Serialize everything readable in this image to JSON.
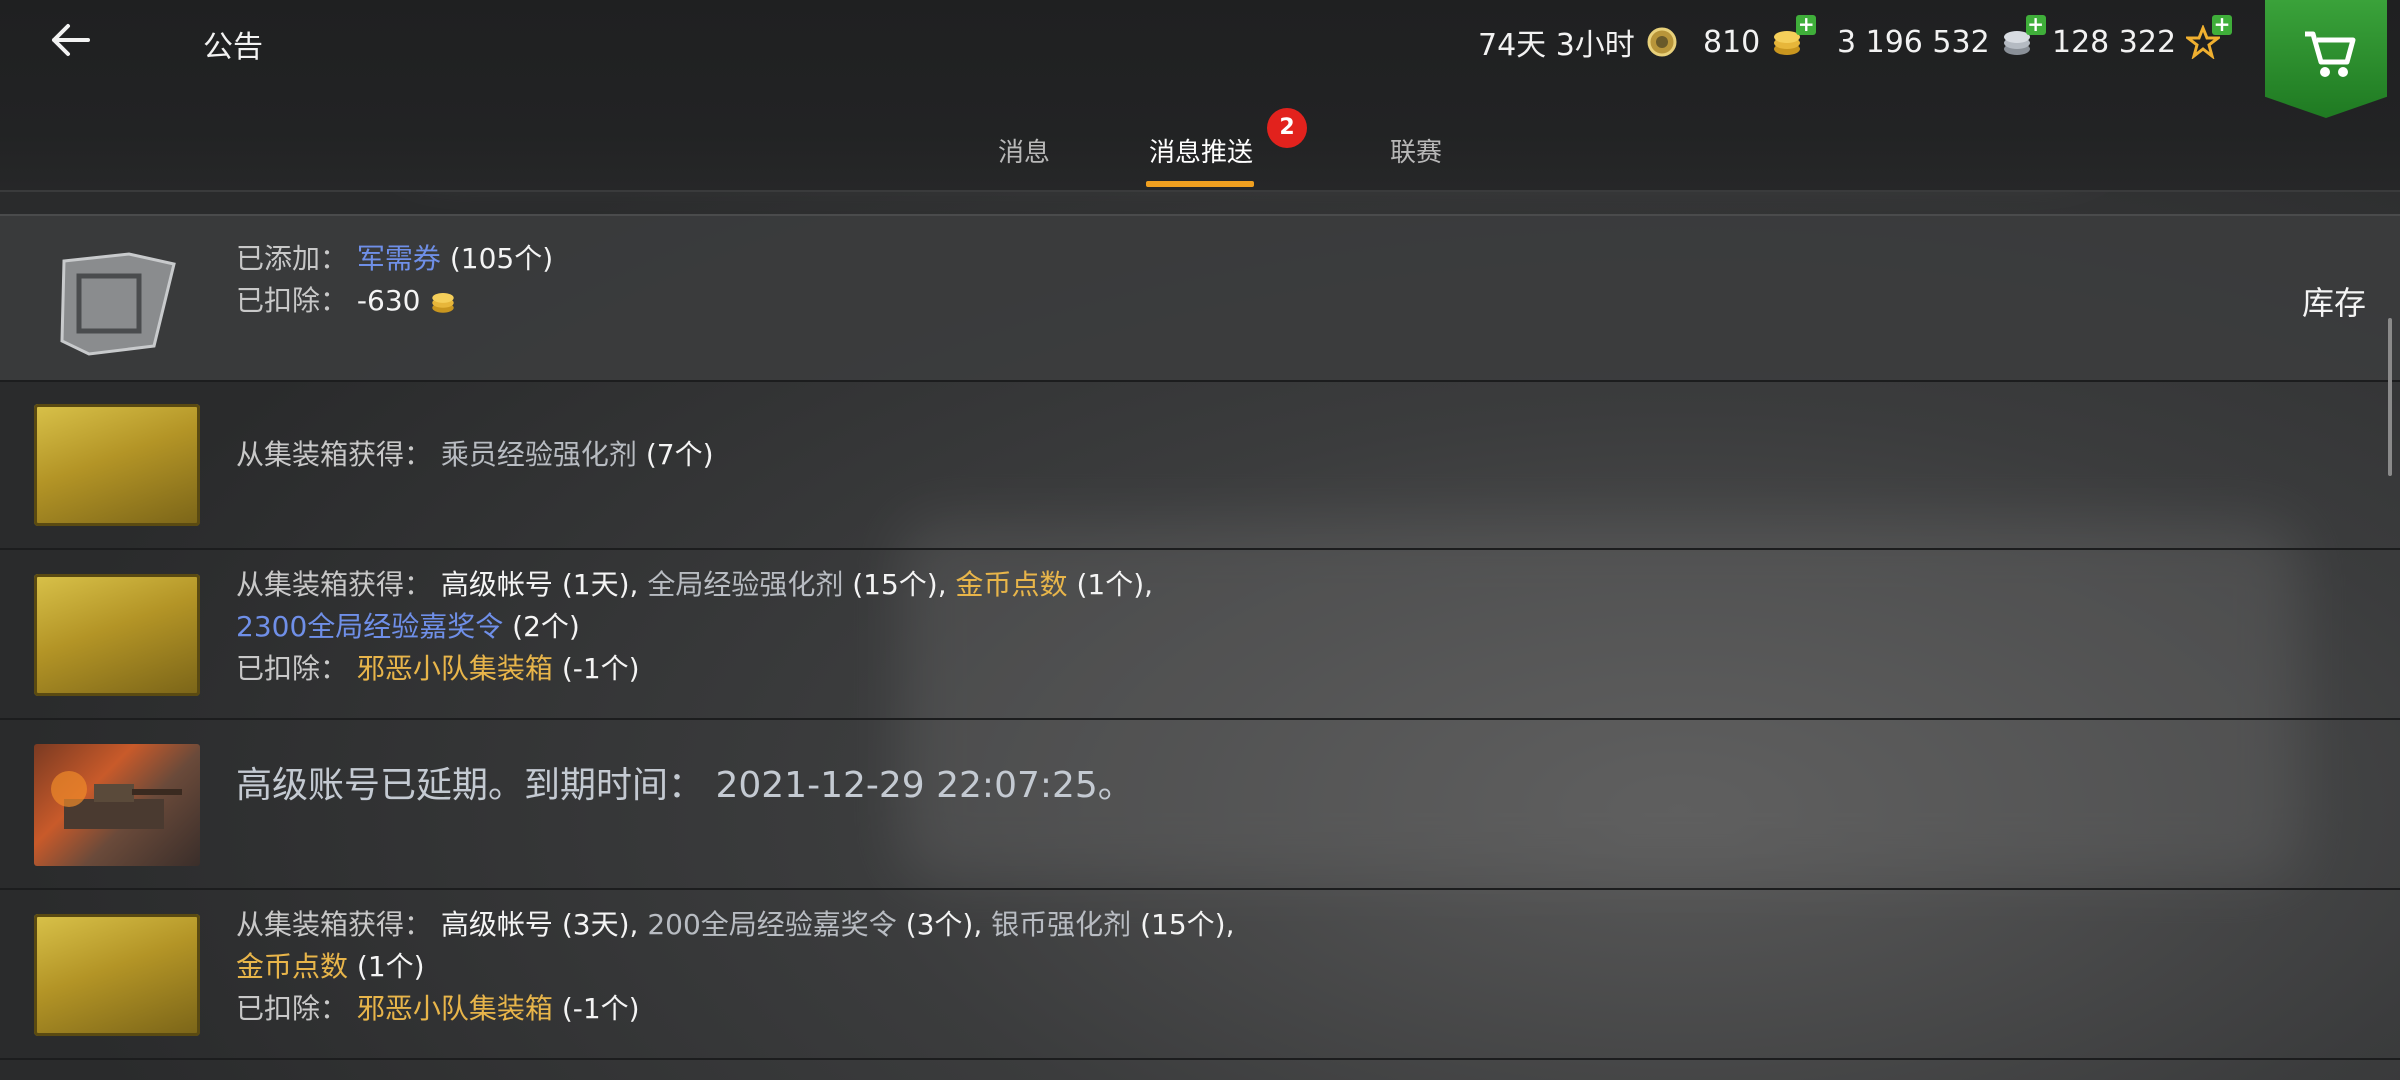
{
  "header": {
    "title": "公告",
    "premium_time": "74天 3小时",
    "gold": "810",
    "silver": "3 196 532",
    "free_xp": "128 322"
  },
  "tabs": [
    {
      "label": "消息"
    },
    {
      "label": "消息推送"
    },
    {
      "label": "联赛"
    }
  ],
  "tab_badge": "2",
  "side_panel": {
    "label": "库存"
  },
  "messages": [
    {
      "added_label": "已添加：",
      "added_item": "军需券",
      "added_qty": "(105个)",
      "deducted_label": "已扣除：",
      "deducted_value": "-630"
    },
    {
      "source_label": "从集装箱获得：",
      "item1": "乘员经验强化剂",
      "item1_qty": "(7个)"
    },
    {
      "source_label": "从集装箱获得：",
      "item1": "高级帐号",
      "item1_qty": "(1天)",
      "item2": "全局经验强化剂",
      "item2_qty": "(15个)",
      "item3": "金币点数",
      "item3_qty": "(1个)",
      "item4": "2300全局经验嘉奖令",
      "item4_qty": "(2个)",
      "deducted_label": "已扣除：",
      "deducted_item": "邪恶小队集装箱",
      "deducted_qty": "(-1个)"
    },
    {
      "text": "高级账号已延期。到期时间：",
      "datetime": "2021-12-29 22:07:25。"
    },
    {
      "source_label": "从集装箱获得：",
      "item1": "高级帐号",
      "item1_qty": "(3天)",
      "item2": "200全局经验嘉奖令",
      "item2_qty": "(3个)",
      "item3": "银币强化剂",
      "item3_qty": "(15个)",
      "item4": "金币点数",
      "item4_qty": "(1个)",
      "deducted_label": "已扣除：",
      "deducted_item": "邪恶小队集装箱",
      "deducted_qty": "(-1个)"
    }
  ],
  "colors": {
    "accent": "#f0a020",
    "badge": "#e2221d",
    "shop": "#2e8f2e",
    "link_blue": "#6f8fe8",
    "link_gold": "#e8b54a"
  }
}
